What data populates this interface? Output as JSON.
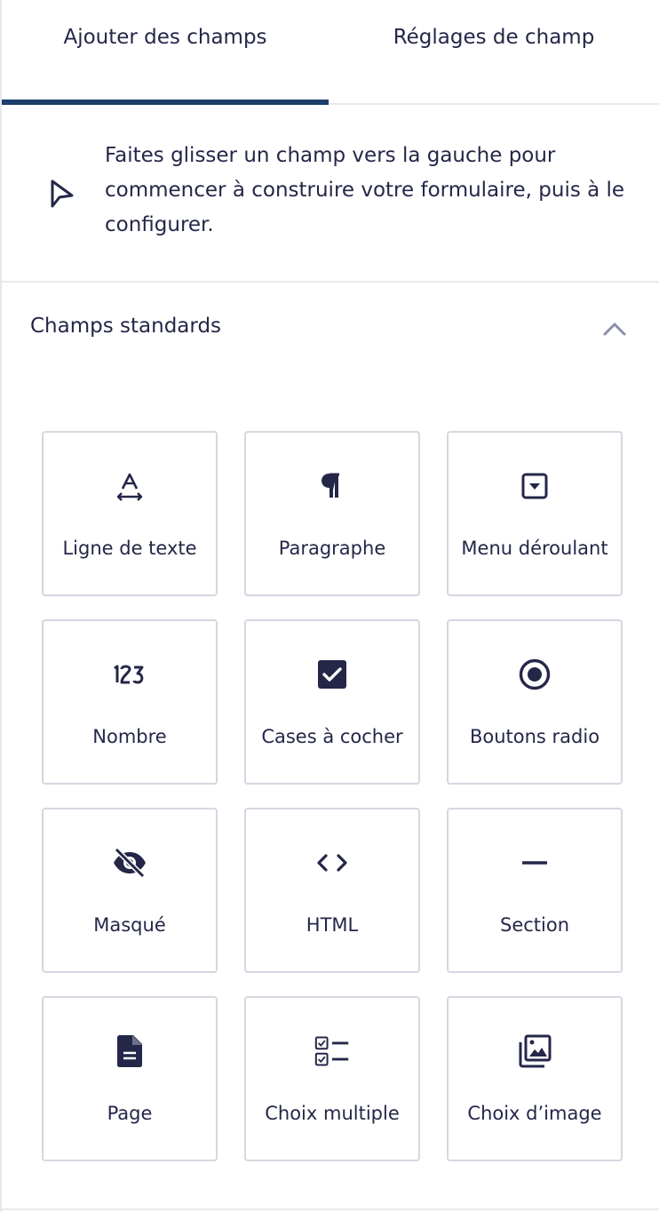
{
  "tabs": {
    "add_fields": "Ajouter des champs",
    "field_settings": "Réglages de champ"
  },
  "hint": {
    "text": "Faites glisser un champ vers la gauche pour commencer à construire votre formulaire, puis à le configurer."
  },
  "section": {
    "title": "Champs standards",
    "expanded": true
  },
  "fields": [
    {
      "label": "Ligne de texte",
      "icon": "text-line-icon"
    },
    {
      "label": "Paragraphe",
      "icon": "paragraph-icon"
    },
    {
      "label": "Menu déroulant",
      "icon": "dropdown-icon"
    },
    {
      "label": "Nombre",
      "icon": "number-icon"
    },
    {
      "label": "Cases à cocher",
      "icon": "checkbox-icon"
    },
    {
      "label": "Boutons radio",
      "icon": "radio-icon"
    },
    {
      "label": "Masqué",
      "icon": "hidden-icon"
    },
    {
      "label": "HTML",
      "icon": "code-icon"
    },
    {
      "label": "Section",
      "icon": "section-icon"
    },
    {
      "label": "Page",
      "icon": "page-icon"
    },
    {
      "label": "Choix multiple",
      "icon": "multiple-choice-icon"
    },
    {
      "label": "Choix d’image",
      "icon": "image-choice-icon"
    }
  ],
  "colors": {
    "text": "#242748",
    "tab_underline": "#1d3f6a",
    "border": "#d5d7e1",
    "divider": "#e8e9ef",
    "chevron": "#8a8fa8"
  }
}
